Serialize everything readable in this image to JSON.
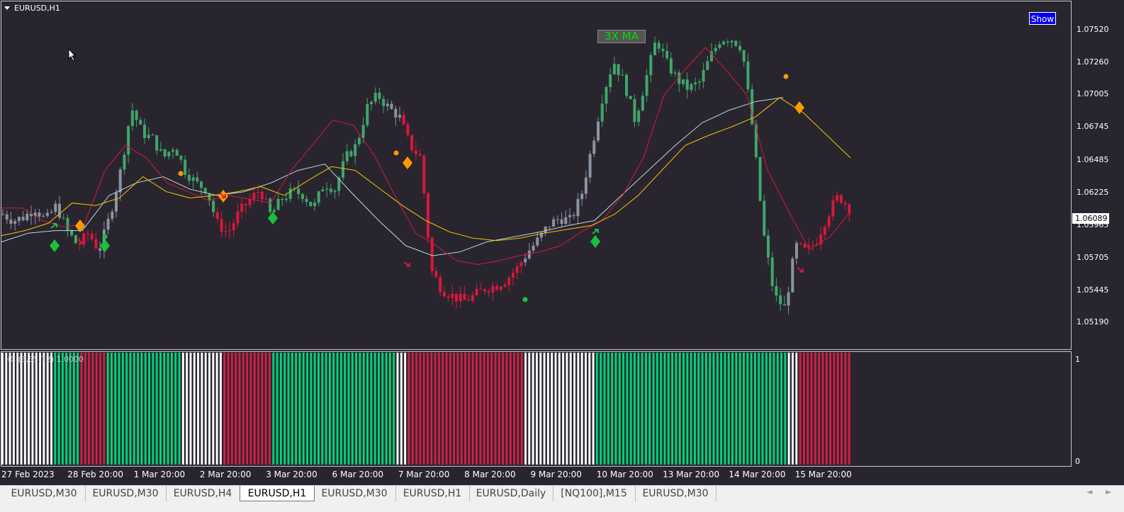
{
  "chart_window": {
    "symbol_title": "EURUSD,H1",
    "show_button": "Show",
    "ma_label": "3X MA",
    "indicator_label": "HC (3,35,72) 1.0000",
    "current_price": "1.06089"
  },
  "colors": {
    "background": "#29252f",
    "bull_candle": "#3fa66b",
    "bear_candle": "#d8173c",
    "neutral_candle": "#8a93a3",
    "ma_fast": "#d8173c",
    "ma_slow": "#f5c400",
    "ma_mid": "#b8d8e0",
    "histogram_green": "#00d57a",
    "histogram_red": "#d21f45",
    "histogram_white": "#ffffff",
    "signal_orange": "#ff9900",
    "signal_green": "#19c23a"
  },
  "chart_data": {
    "type": "line",
    "ylim": [
      1.0506,
      1.076
    ],
    "y_ticks": [
      "1.07520",
      "1.07260",
      "1.07005",
      "1.06745",
      "1.06485",
      "1.06225",
      "1.05965",
      "1.05705",
      "1.05445",
      "1.05190"
    ],
    "x_ticks": [
      "27 Feb 2023",
      "28 Feb 20:00",
      "1 Mar 20:00",
      "2 Mar 20:00",
      "3 Mar 20:00",
      "6 Mar 20:00",
      "7 Mar 20:00",
      "8 Mar 20:00",
      "9 Mar 20:00",
      "10 Mar 20:00",
      "13 Mar 20:00",
      "14 Mar 20:00",
      "15 Mar 20:00"
    ],
    "price_path": [
      1.0605,
      1.06,
      1.0603,
      1.061,
      1.06,
      1.0612,
      1.0592,
      1.058,
      1.059,
      1.0576,
      1.0604,
      1.064,
      1.069,
      1.067,
      1.0665,
      1.065,
      1.066,
      1.064,
      1.063,
      1.0625,
      1.0598,
      1.059,
      1.0606,
      1.0616,
      1.0625,
      1.0604,
      1.0617,
      1.0623,
      1.0621,
      1.061,
      1.063,
      1.0625,
      1.065,
      1.066,
      1.069,
      1.07,
      1.069,
      1.0683,
      1.066,
      1.065,
      1.056,
      1.0545,
      1.054,
      1.0536,
      1.054,
      1.0546,
      1.0548,
      1.0553,
      1.0562,
      1.0575,
      1.0585,
      1.0597,
      1.0602,
      1.06,
      1.062,
      1.066,
      1.07,
      1.0727,
      1.071,
      1.068,
      1.0712,
      1.0745,
      1.0725,
      1.0712,
      1.0705,
      1.071,
      1.073,
      1.0745,
      1.0745,
      1.0738,
      1.0672,
      1.059,
      1.054,
      1.053,
      1.058,
      1.0575,
      1.0585,
      1.0605,
      1.062,
      1.061
    ],
    "ma_fast": [
      1.061,
      1.061,
      1.06,
      1.0595,
      1.0597,
      1.064,
      1.066,
      1.065,
      1.063,
      1.0623,
      1.0616,
      1.062,
      1.0617,
      1.0614,
      1.064,
      1.066,
      1.068,
      1.0676,
      1.0652,
      1.062,
      1.059,
      1.058,
      1.0568,
      1.0565,
      1.0568,
      1.0572,
      1.0575,
      1.058,
      1.0591,
      1.06,
      1.062,
      1.065,
      1.07,
      1.072,
      1.0738,
      1.072,
      1.07,
      1.064,
      1.0608,
      1.0577,
      1.0587,
      1.0607
    ],
    "ma_slow": [
      1.0588,
      1.0592,
      1.0598,
      1.0614,
      1.0612,
      1.0618,
      1.0635,
      1.0623,
      1.0618,
      1.062,
      1.0623,
      1.0627,
      1.062,
      1.0632,
      1.0643,
      1.064,
      1.0626,
      1.0612,
      1.06,
      1.0591,
      1.0586,
      1.0584,
      1.0586,
      1.059,
      1.0593,
      1.0596,
      1.0605,
      1.062,
      1.064,
      1.066,
      1.0668,
      1.0675,
      1.0683,
      1.0698,
      1.0686,
      1.0668,
      1.065
    ],
    "ma_mid": [
      1.0583,
      1.059,
      1.0592,
      1.0592,
      1.062,
      1.063,
      1.0635,
      1.0625,
      1.062,
      1.0623,
      1.063,
      1.064,
      1.0645,
      1.0622,
      1.06,
      1.058,
      1.0572,
      1.0575,
      1.0583,
      1.0587,
      1.0591,
      1.0596,
      1.06,
      1.062,
      1.064,
      1.066,
      1.0678,
      1.0688,
      1.0695,
      1.0698
    ]
  },
  "histogram": {
    "segments": [
      {
        "color": "white",
        "bars": 14
      },
      {
        "color": "green",
        "bars": 7
      },
      {
        "color": "red",
        "bars": 7
      },
      {
        "color": "green",
        "bars": 20
      },
      {
        "color": "white",
        "bars": 11
      },
      {
        "color": "red",
        "bars": 13
      },
      {
        "color": "green",
        "bars": 33
      },
      {
        "color": "white",
        "bars": 3
      },
      {
        "color": "red",
        "bars": 31
      },
      {
        "color": "white",
        "bars": 19
      },
      {
        "color": "green",
        "bars": 51
      },
      {
        "color": "white",
        "bars": 3
      },
      {
        "color": "red",
        "bars": 14
      }
    ],
    "labels": {
      "top": "1",
      "bottom": "0"
    }
  },
  "tabs": [
    {
      "label": "EURUSD,M30"
    },
    {
      "label": "EURUSD,M30"
    },
    {
      "label": "EURUSD,H4"
    },
    {
      "label": "EURUSD,H1",
      "active": true
    },
    {
      "label": "EURUSD,M30"
    },
    {
      "label": "EURUSD,H1"
    },
    {
      "label": "EURUSD,Daily"
    },
    {
      "label": "[NQ100],M15"
    },
    {
      "label": "EURUSD,M30"
    }
  ]
}
